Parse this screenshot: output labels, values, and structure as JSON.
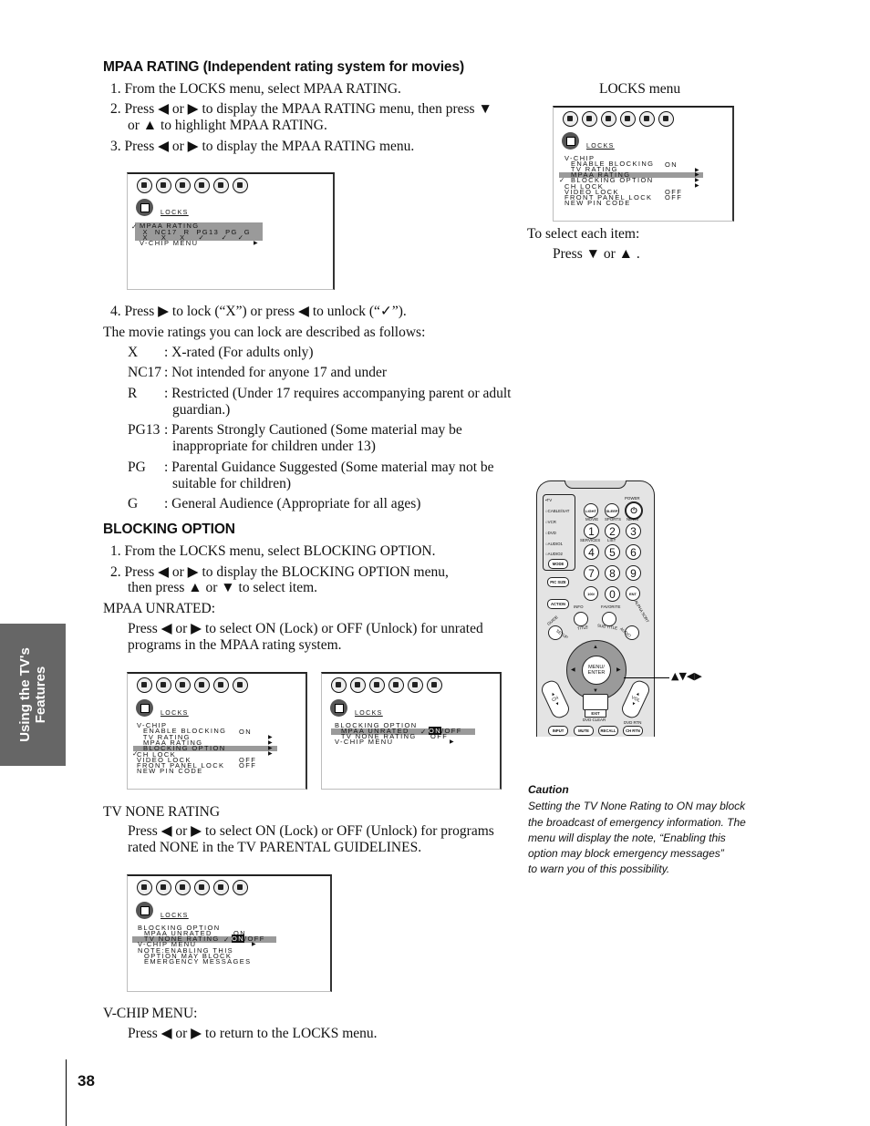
{
  "side_tab": {
    "line1": "Using the TV's",
    "line2": "Features"
  },
  "page_number": "38",
  "mpaa": {
    "heading": "MPAA RATING (Independent rating system for movies)",
    "steps": [
      "1. From the LOCKS menu, select MPAA RATING.",
      "2. Press ◀ or ▶ to display the MPAA RATING menu, then press ▼",
      "or ▲ to highlight MPAA RATING.",
      "3. Press ◀ or ▶ to display the MPAA RATING menu.",
      "4. Press ▶ to lock (“X”) or press ◀ to unlock (“✓”)."
    ],
    "ratings_intro": "The movie ratings you can lock are described as follows:",
    "ratings": [
      {
        "code": "X",
        "desc": ": X-rated (For adults only)",
        "desc2": ""
      },
      {
        "code": "NC17",
        "desc": ": Not intended for anyone 17 and under",
        "desc2": ""
      },
      {
        "code": "R",
        "desc": ": Restricted (Under 17 requires accompanying parent or adult",
        "desc2": "guardian.)"
      },
      {
        "code": "PG13",
        "desc": ": Parents Strongly Cautioned (Some material may be",
        "desc2": "inappropriate for children under 13)"
      },
      {
        "code": "PG",
        "desc": ": Parental Guidance Suggested (Some material may not be",
        "desc2": "suitable for children)"
      },
      {
        "code": "G",
        "desc": ": General Audience (Appropriate for all ages)",
        "desc2": ""
      }
    ]
  },
  "blocking": {
    "heading": "BLOCKING OPTION",
    "steps": [
      "1. From the LOCKS menu, select BLOCKING OPTION.",
      "2. Press ◀ or ▶ to display the BLOCKING OPTION menu,",
      "then press ▲ or ▼ to select item."
    ],
    "mpaa_unrated_label": "MPAA UNRATED:",
    "mpaa_unrated_text1": "Press ◀ or ▶ to select ON (Lock) or OFF (Unlock) for unrated",
    "mpaa_unrated_text2": "programs in the MPAA rating system.",
    "tv_none_label": "TV NONE RATING",
    "tv_none_text1": "Press ◀ or ▶ to select ON (Lock) or OFF (Unlock) for programs",
    "tv_none_text2": "rated NONE in the TV PARENTAL GUIDELINES.",
    "vchip_label": "V-CHIP MENU:",
    "vchip_text": "Press ◀ or ▶ to return to the LOCKS menu."
  },
  "locks_menu_caption": "LOCKS menu",
  "select_item": {
    "line1": "To select each item:",
    "line2": "Press ▼ or ▲ ."
  },
  "nav_arrows_label": "▲▼◀▶",
  "caution": {
    "title": "Caution",
    "lines": [
      "Setting the TV None Rating to ON may block",
      "the broadcast of emergency information. The",
      "menu will display the note, “Enabling this",
      "option may block emergency messages”",
      "to warn you of this possibility."
    ]
  },
  "osd": {
    "locks_title": "LOCKS",
    "mpaa_screen": {
      "row1": "MPAA RATING",
      "row2": " X  NC17  R  PG13  PG  G",
      "row3": " X    X    X    ✓     ✓   ✓",
      "row4": "V-CHIP MENU"
    },
    "locks_screen": {
      "rows": [
        {
          "label": "V-CHIP",
          "value": "",
          "arrow": false
        },
        {
          "label": "  ENABLE BLOCKING",
          "value": "ON",
          "arrow": false
        },
        {
          "label": "  TV RATING",
          "value": "",
          "arrow": true
        },
        {
          "label": "  MPAA RATING",
          "value": "",
          "arrow": true
        },
        {
          "label": "  BLOCKING OPTION",
          "value": "",
          "arrow": true
        },
        {
          "label": "CH LOCK",
          "value": "",
          "arrow": true
        },
        {
          "label": "VIDEO LOCK",
          "value": "OFF",
          "arrow": false
        },
        {
          "label": "FRONT PANEL LOCK",
          "value": "OFF",
          "arrow": false
        },
        {
          "label": "NEW PIN CODE",
          "value": "",
          "arrow": false
        }
      ]
    },
    "blocking_screen": {
      "row1": "BLOCKING OPTION",
      "row2": "  MPAA UNRATED",
      "row3": "  TV NONE RATING",
      "row4": "V-CHIP MENU",
      "on": "ON",
      "off_sep": "/OFF",
      "off": "OFF"
    },
    "tvnone_screen": {
      "row1": "BLOCKING OPTION",
      "row2": "  MPAA UNRATED",
      "row2_val": "ON",
      "row3": "  TV NONE RATING",
      "row4": "V-CHIP MENU",
      "note1": "NOTE:ENABLING THIS",
      "note2": "  OPTION MAY BLOCK",
      "note3": "  EMERGENCY MESSAGES",
      "on": "ON",
      "off_sep": "/OFF"
    }
  },
  "remote": {
    "modes": [
      "▪TV",
      "○CABLE/SAT",
      "○VCR",
      "○DVD",
      "○AUDIO1",
      "○AUDIO2"
    ],
    "mode_btn": "MODE",
    "power": "POWER",
    "light": "LIGHT",
    "sleep": "SLEEP",
    "top_labels": [
      "MOVIE",
      "SPORTS",
      "NEWS"
    ],
    "mid_labels": [
      "SERVICES",
      "LIST"
    ],
    "digits": [
      "1",
      "2",
      "3",
      "4",
      "5",
      "6",
      "7",
      "8",
      "9",
      "100/",
      "0",
      "ENT"
    ],
    "pic_size": "PIC SIZE",
    "action": "ACTION",
    "info": "INFO",
    "favorite": "FAVORITE",
    "guide": "GUIDE",
    "setup": "SETUP",
    "title": "TITLE",
    "subtitle": "SUB TITLE",
    "audio": "AUDIO",
    "alpha_sort": "ALPHA SORT",
    "menu_enter": "MENU/ ENTER",
    "ch": "CH",
    "vol": "VOL",
    "exit": "EXIT",
    "dvd_clear": "DVD CLEAR",
    "input": "INPUT",
    "mute": "MUTE",
    "recall": "RECALL",
    "dvd_rtn": "DVD RTN",
    "ch_rtn": "CH RTN"
  }
}
